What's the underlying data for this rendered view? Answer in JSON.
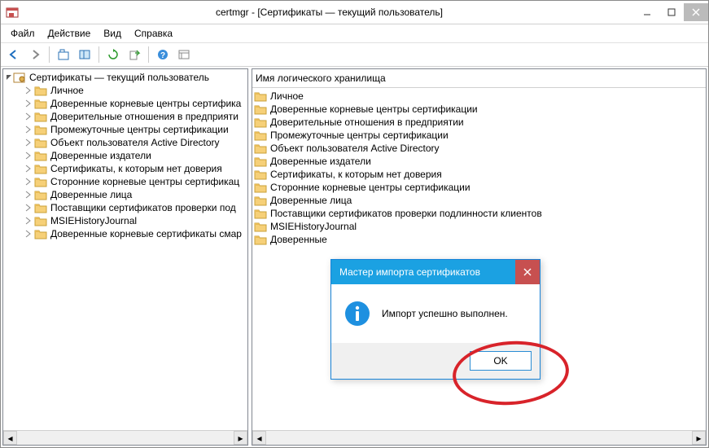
{
  "titlebar": {
    "title": "certmgr - [Сертификаты — текущий пользователь]"
  },
  "menu": {
    "file": "Файл",
    "action": "Действие",
    "view": "Вид",
    "help": "Справка"
  },
  "tree": {
    "root": "Сертификаты — текущий пользователь",
    "items": [
      "Личное",
      "Доверенные корневые центры сертифика",
      "Доверительные отношения в предприяти",
      "Промежуточные центры сертификации",
      "Объект пользователя Active Directory",
      "Доверенные издатели",
      "Сертификаты, к которым нет доверия",
      "Сторонние корневые центры сертификац",
      "Доверенные лица",
      "Поставщики сертификатов проверки под",
      "MSIEHistoryJournal",
      "Доверенные корневые сертификаты смар"
    ]
  },
  "list": {
    "header": "Имя логического хранилища",
    "items": [
      "Личное",
      "Доверенные корневые центры сертификации",
      "Доверительные отношения в предприятии",
      "Промежуточные центры сертификации",
      "Объект пользователя Active Directory",
      "Доверенные издатели",
      "Сертификаты, к которым нет доверия",
      "Сторонние корневые центры сертификации",
      "Доверенные лица",
      "Поставщики сертификатов проверки подлинности клиентов",
      "MSIEHistoryJournal",
      "Доверенные"
    ]
  },
  "dialog": {
    "title": "Мастер импорта сертификатов",
    "message": "Импорт успешно выполнен.",
    "ok": "OK"
  }
}
